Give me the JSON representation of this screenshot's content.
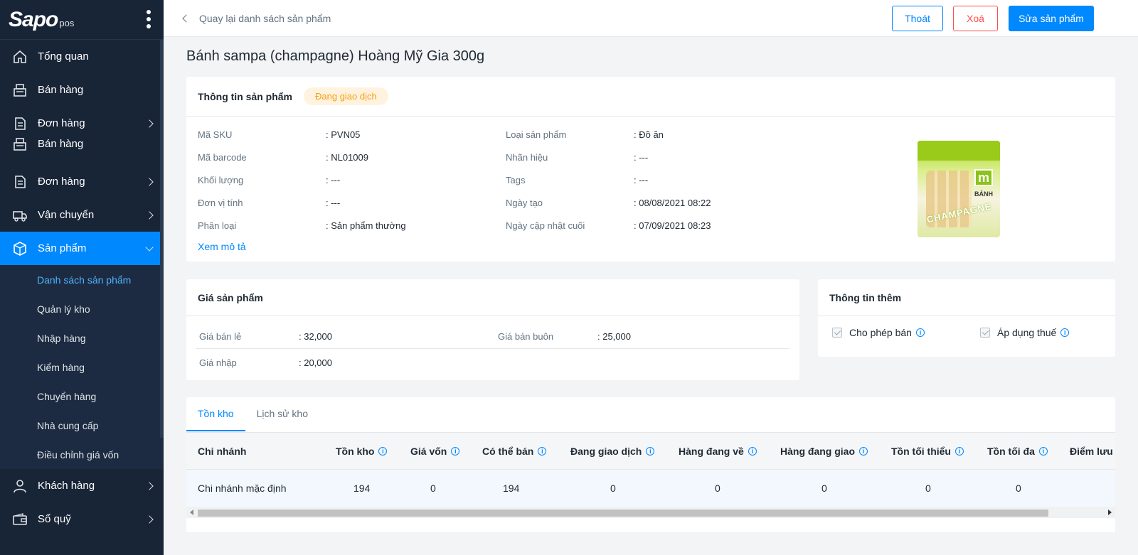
{
  "brand": {
    "logo": "Sapo",
    "sub": "pos"
  },
  "sidebar": {
    "items": [
      {
        "label": "Tổng quan",
        "icon": "home-icon"
      },
      {
        "label": "Bán hàng",
        "icon": "cash-register-icon"
      },
      {
        "label": "Đơn hàng",
        "icon": "order-icon"
      },
      {
        "label": "Bán hàng",
        "icon": "cash-register-icon"
      },
      {
        "label": "Đơn hàng",
        "icon": "order-icon"
      },
      {
        "label": "Vận chuyển",
        "icon": "truck-icon"
      },
      {
        "label": "Sản phẩm",
        "icon": "box-icon"
      },
      {
        "label": "Khách hàng",
        "icon": "user-icon"
      },
      {
        "label": "Sổ quỹ",
        "icon": "wallet-icon"
      }
    ],
    "sub_items": [
      "Danh sách sản phẩm",
      "Quản lý kho",
      "Nhập hàng",
      "Kiểm hàng",
      "Chuyển hàng",
      "Nhà cung cấp",
      "Điều chỉnh giá vốn"
    ]
  },
  "topbar": {
    "back_label": "Quay lại danh sách sản phẩm",
    "exit_label": "Thoát",
    "delete_label": "Xoá",
    "edit_label": "Sửa sản phẩm"
  },
  "product": {
    "title": "Bánh sampa (champagne) Hoàng Mỹ Gia 300g",
    "section_title": "Thông tin sản phẩm",
    "status": "Đang giao dịch",
    "left_fields": [
      {
        "label": "Mã SKU",
        "value": ": PVN05"
      },
      {
        "label": "Mã barcode",
        "value": ": NL01009"
      },
      {
        "label": "Khối lượng",
        "value": ": ---"
      },
      {
        "label": "Đơn vị tính",
        "value": ": ---"
      },
      {
        "label": "Phân loại",
        "value": ": Sản phẩm thường"
      }
    ],
    "right_fields": [
      {
        "label": "Loại sản phẩm",
        "value": ": Đồ ăn"
      },
      {
        "label": "Nhãn hiệu",
        "value": ": ---"
      },
      {
        "label": "Tags",
        "value": ": ---"
      },
      {
        "label": "Ngày tạo",
        "value": ": 08/08/2021 08:22"
      },
      {
        "label": "Ngày cập nhật cuối",
        "value": ": 07/09/2021 08:23"
      }
    ],
    "description_link": "Xem mô tả",
    "image_text": {
      "m": "m",
      "ban": "BÁNH",
      "champ": "CHAMPAGNE"
    }
  },
  "price": {
    "title": "Giá sản phẩm",
    "retail_label": "Giá bán lẻ",
    "retail_value": ": 32,000",
    "wholesale_label": "Giá bán buôn",
    "wholesale_value": ": 25,000",
    "import_label": "Giá nhập",
    "import_value": ": 20,000"
  },
  "extra": {
    "title": "Thông tin thêm",
    "allow_sale": "Cho phép bán",
    "apply_tax": "Áp dụng thuế"
  },
  "inventory": {
    "tabs": [
      "Tồn kho",
      "Lịch sử kho"
    ],
    "columns": [
      "Chi nhánh",
      "Tồn kho",
      "Giá vốn",
      "Có thể bán",
      "Đang giao dịch",
      "Hàng đang về",
      "Hàng đang giao",
      "Tồn tối thiểu",
      "Tồn tối đa",
      "Điểm lưu k"
    ],
    "rows": [
      [
        "Chi nhánh mặc định",
        "194",
        "0",
        "194",
        "0",
        "0",
        "0",
        "0",
        "0",
        ""
      ]
    ]
  },
  "colors": {
    "accent": "#0088ff",
    "sidebar": "#182537",
    "danger": "#ff4d4d",
    "badge": "#f59e0b"
  }
}
